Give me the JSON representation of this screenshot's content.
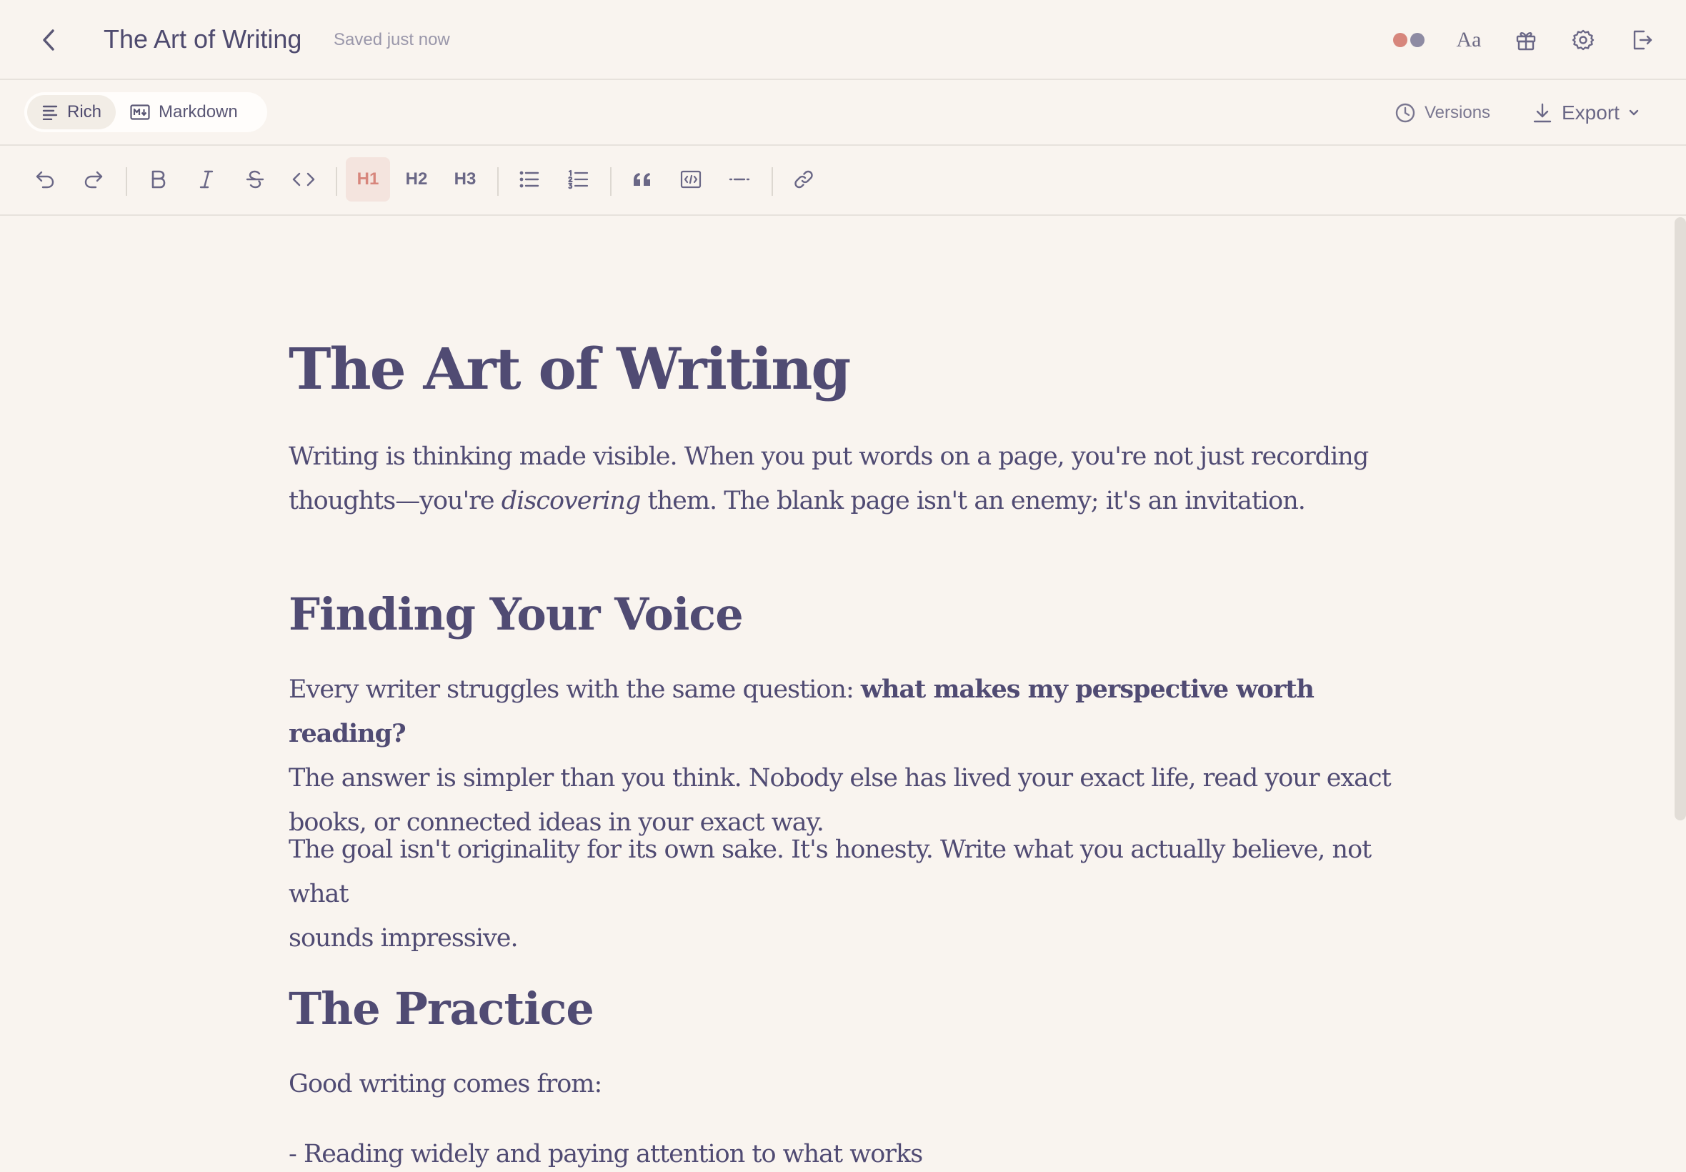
{
  "header": {
    "back_icon": "chevron-left-icon",
    "title": "The Art of Writing",
    "save_status": "Saved just now",
    "theme_colors": [
      "#d7867c",
      "#8e8ba3"
    ],
    "font_label": "Aa",
    "icons": [
      "gift-icon",
      "gear-icon",
      "logout-icon"
    ]
  },
  "modebar": {
    "rich_label": "Rich",
    "markdown_label": "Markdown",
    "versions_label": "Versions",
    "export_label": "Export"
  },
  "toolbar": {
    "h1": "H1",
    "h2": "H2",
    "h3": "H3",
    "active": "H1"
  },
  "document": {
    "title": "The Art of Writing",
    "intro_1": "Writing is thinking made visible. When you put words on a page, you're not just recording",
    "intro_2a": "thoughts—you're ",
    "intro_2_em": "discovering",
    "intro_2b": " them. The blank page isn't an enemy; it's an invitation.",
    "section1_title": "Finding Your Voice",
    "s1p1_a": "Every writer struggles with the same question: ",
    "s1p1_strong": "what makes my perspective worth reading?",
    "s1p1_b": "The answer is simpler than you think. Nobody else has lived your exact life, read your exact",
    "s1p1_c": "books, or connected ideas in your exact way.",
    "s1p2_a": "The goal isn't originality for its own sake. It's honesty. Write what you actually believe, not what",
    "s1p2_b": "sounds impressive.",
    "section2_title": "The Practice",
    "s2p1": "Good writing comes from:",
    "s2_item1": "- Reading widely and paying attention to what works"
  },
  "accent_color": "#d7867c",
  "text_color": "#504b73",
  "background_color": "#f9f4ef"
}
